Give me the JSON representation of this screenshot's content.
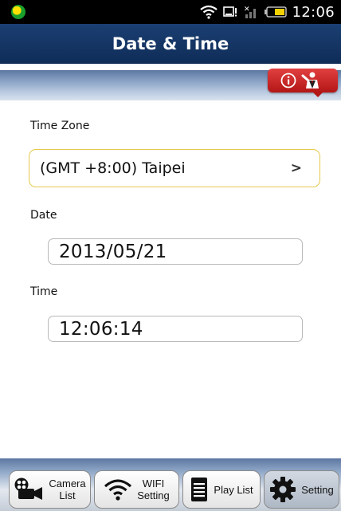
{
  "status_bar": {
    "time": "12:06",
    "icons": [
      "app-icon",
      "wifi-icon",
      "notification-icon",
      "signal-icon",
      "battery-icon"
    ]
  },
  "header": {
    "title": "Date & Time"
  },
  "help_button": {
    "icons": [
      "info-icon",
      "help-person-icon"
    ]
  },
  "form": {
    "time_zone": {
      "label": "Time Zone",
      "value": "(GMT +8:00) Taipei"
    },
    "date": {
      "label": "Date",
      "value": "2013/05/21"
    },
    "time": {
      "label": "Time",
      "value": "12:06:14"
    }
  },
  "tabs": [
    {
      "label": "Camera\nList",
      "icon": "camera-icon",
      "active": false
    },
    {
      "label": "WIFI\nSetting",
      "icon": "wifi-icon",
      "active": false
    },
    {
      "label": "Play List",
      "icon": "document-icon",
      "active": false
    },
    {
      "label": "Setting",
      "icon": "gear-icon",
      "active": true
    }
  ],
  "colors": {
    "header": "#1b3f73",
    "accent_border": "#e6c84a",
    "help_red": "#cc2222"
  }
}
